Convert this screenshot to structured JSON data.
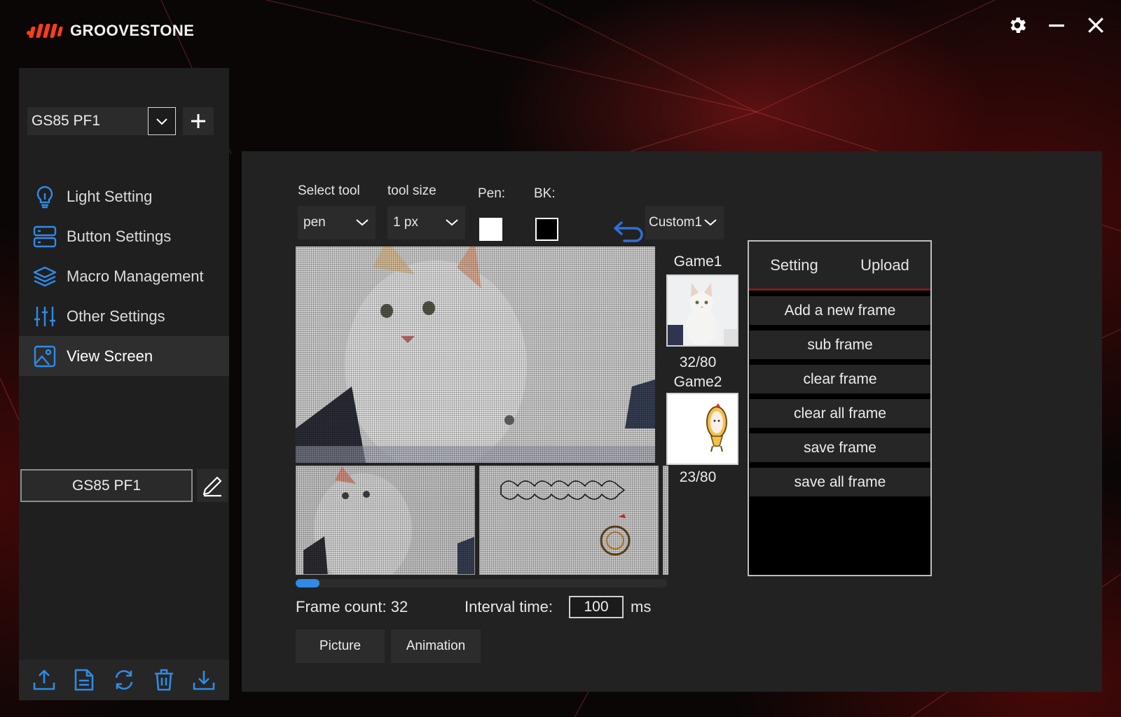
{
  "app": {
    "brand": "GROOVESTONE",
    "accent_color": "#2f8be6",
    "brand_color": "#ff3b1f"
  },
  "window_controls": [
    "gear-icon",
    "minimize-icon",
    "close-icon"
  ],
  "sidebar": {
    "profile_select": {
      "value": "GS85 PF1"
    },
    "nav_items": [
      {
        "label": "Light Setting",
        "icon": "lightbulb-icon"
      },
      {
        "label": "Button Settings",
        "icon": "server-icon"
      },
      {
        "label": "Macro Management",
        "icon": "layers-icon"
      },
      {
        "label": "Other Settings",
        "icon": "sliders-icon"
      },
      {
        "label": "View Screen",
        "icon": "image-icon",
        "active": true
      }
    ],
    "profile_name": "GS85 PF1",
    "bottom_actions": [
      "upload-icon",
      "document-icon",
      "refresh-icon",
      "trash-icon",
      "download-icon"
    ]
  },
  "editor": {
    "select_tool_label": "Select tool",
    "select_tool_value": "pen",
    "tool_size_label": "tool size",
    "tool_size_value": "1 px",
    "pen_label": "Pen:",
    "pen_color": "#ffffff",
    "bk_label": "BK:",
    "bk_color": "#000000",
    "preset_value": "Custom1",
    "frame_count_text": "Frame count: 32",
    "interval_label": "Interval time:",
    "interval_value": "100",
    "interval_unit": "ms",
    "picture_button": "Picture",
    "animation_button": "Animation",
    "scroll_position": 0.0
  },
  "games": [
    {
      "label": "Game1",
      "count": "32/80"
    },
    {
      "label": "Game2",
      "count": "23/80"
    }
  ],
  "frame_panel": {
    "tabs": [
      "Setting",
      "Upload"
    ],
    "buttons": [
      "Add a new frame",
      "sub frame",
      "clear frame",
      "clear all frame",
      "save frame",
      "save all frame"
    ]
  }
}
